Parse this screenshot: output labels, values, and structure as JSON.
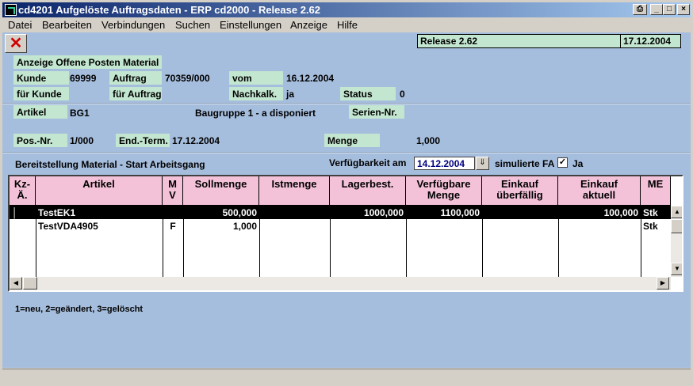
{
  "window": {
    "title": "cd4201 Aufgelöste Auftragsdaten - ERP cd2000 - Release 2.62"
  },
  "titlebar_buttons": {
    "minimize": "_",
    "maximize": "□",
    "close": "×"
  },
  "menu": [
    "Datei",
    "Bearbeiten",
    "Verbindungen",
    "Suchen",
    "Einstellungen",
    "Anzeige",
    "Hilfe"
  ],
  "toolbar": {
    "close_glyph": "✕",
    "release": "Release 2.62",
    "date": "17.12.2004"
  },
  "header": {
    "section_title": "Anzeige Offene Posten Material"
  },
  "fields": {
    "kunde_label": "Kunde",
    "kunde": "69999",
    "auftrag_label": "Auftrag",
    "auftrag": "70359/000",
    "vom_label": "vom",
    "vom": "16.12.2004",
    "fuer_kunde_label": "für Kunde",
    "fuer_auftrag_label": "für Auftrag",
    "nachkalk_label": "Nachkalk.",
    "nachkalk": "ja",
    "status_label": "Status",
    "status": "0",
    "artikel_label": "Artikel",
    "artikel": "BG1",
    "artikel_desc": "Baugruppe 1 - a disponiert",
    "serien_label": "Serien-Nr.",
    "pos_label": "Pos.-Nr.",
    "pos": "1/000",
    "endterm_label": "End.-Term.",
    "endterm": "17.12.2004",
    "menge_label": "Menge",
    "menge": "1,000"
  },
  "bereitstellung": {
    "title": "Bereitstellung Material - Start Arbeitsgang",
    "verfuegbarkeit_label": "Verfügbarkeit am",
    "verfuegbarkeit_date": "14.12.2004",
    "simulierte_label": "simulierte FA",
    "checkbox_mark": "✓",
    "ja_label": "Ja"
  },
  "grid": {
    "headers": [
      "Kz-\nÄ.",
      "Artikel",
      "M\nV",
      "Sollmenge",
      "Istmenge",
      "Lagerbest.",
      "Verfügbare\nMenge",
      "Einkauf\nüberfällig",
      "Einkauf\naktuell",
      "ME"
    ],
    "rows": [
      {
        "kz": "",
        "artikel": "TestEK1",
        "mv": "",
        "soll": "500,000",
        "ist": "",
        "lager": "1000,000",
        "verf": "1100,000",
        "ek_ueber": "",
        "ek_akt": "100,000",
        "me": "Stk",
        "selected": true
      },
      {
        "kz": "",
        "artikel": "TestVDA4905",
        "mv": "F",
        "soll": "1,000",
        "ist": "",
        "lager": "",
        "verf": "",
        "ek_ueber": "",
        "ek_akt": "",
        "me": "Stk",
        "selected": false
      }
    ]
  },
  "legend": "1=neu, 2=geändert, 3=gelöscht",
  "colors": {
    "label_bg": "#c3e6d0",
    "client_bg": "#a6bedd",
    "header_bg": "#f4c2d8",
    "titlebar": "#0a246a"
  }
}
